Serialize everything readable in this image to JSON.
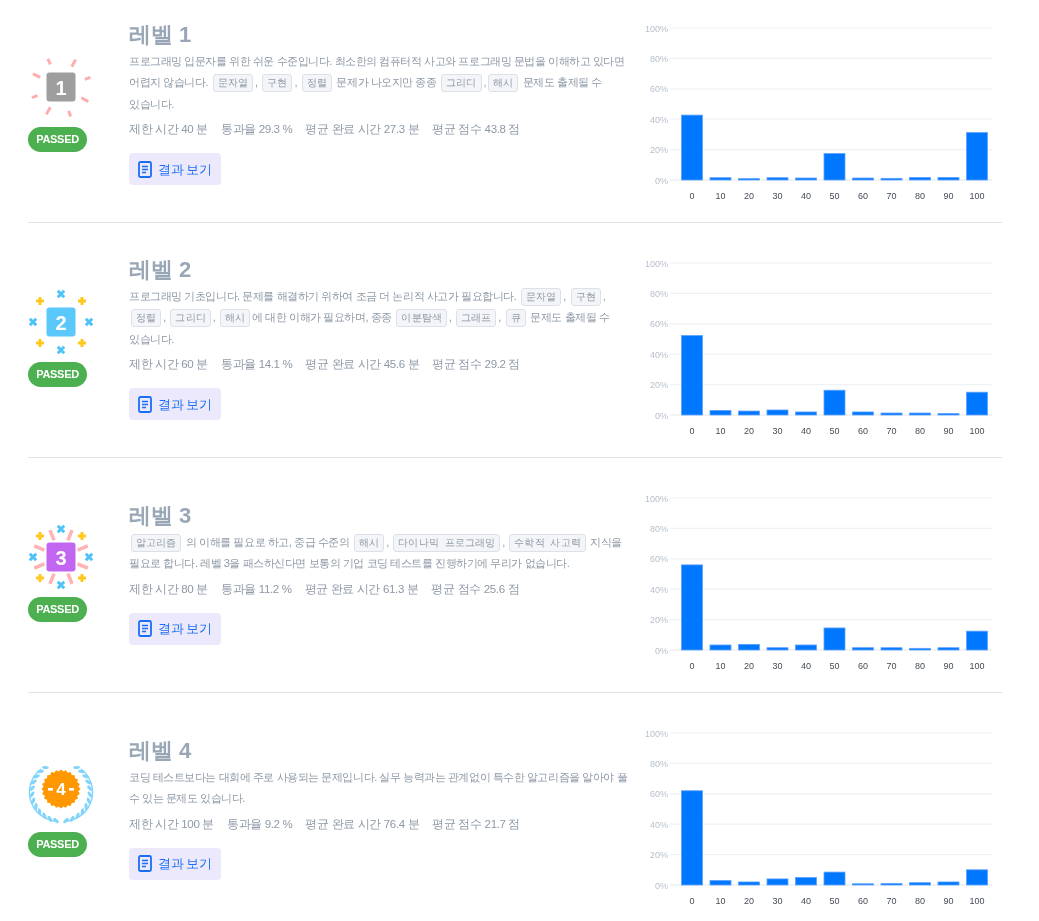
{
  "levels": [
    {
      "title": "레벨 1",
      "badge": {
        "kind": "burst",
        "number": "1"
      },
      "status": "PASSED",
      "description": [
        {
          "kind": "text",
          "text": "프로그래밍 입문자를 위한 쉬운 수준입니다. 최소한의 컴퓨터적 사고와 프로그래밍 문법을 이해하고 있다면 어렵지 않습니다. "
        },
        {
          "kind": "tag",
          "text": "문자열"
        },
        {
          "kind": "text",
          "text": ", "
        },
        {
          "kind": "tag",
          "text": "구현"
        },
        {
          "kind": "text",
          "text": ", "
        },
        {
          "kind": "tag",
          "text": "정렬"
        },
        {
          "kind": "text",
          "text": " 문제가 나오지만 종종 "
        },
        {
          "kind": "tag",
          "text": "그리디"
        },
        {
          "kind": "text",
          "text": ","
        },
        {
          "kind": "tag",
          "text": "해시"
        },
        {
          "kind": "text",
          "text": " 문제도 출제될 수 있습니다."
        }
      ],
      "stats": [
        "제한 시간 40 분",
        "통과율 29.3 %",
        "평균 완료 시간 27.3 분",
        "평균 점수 43.8 점"
      ],
      "button": "결과 보기",
      "chart_data": {
        "type": "bar",
        "categories": [
          "0",
          "10",
          "20",
          "30",
          "40",
          "50",
          "60",
          "70",
          "80",
          "90",
          "100"
        ],
        "values": [
          42.7,
          1.5,
          0.9,
          1.5,
          1.3,
          17.4,
          1.3,
          1.1,
          1.7,
          1.7,
          31.2
        ],
        "ylim": [
          0,
          100
        ],
        "yticks": [
          {
            "value": 0,
            "label": "0%"
          },
          {
            "value": 20,
            "label": "20%"
          },
          {
            "value": 40,
            "label": "40%"
          },
          {
            "value": 60,
            "label": "60%"
          },
          {
            "value": 80,
            "label": "80%"
          },
          {
            "value": 100,
            "label": "100%"
          }
        ],
        "grid": true
      }
    },
    {
      "title": "레벨 2",
      "badge": {
        "kind": "sparkle",
        "number": "2"
      },
      "status": "PASSED",
      "description": [
        {
          "kind": "text",
          "text": "프로그래밍 기초입니다. 문제를 해결하기 위하여 조금 더 논리적 사고가 필요합니다. "
        },
        {
          "kind": "tag",
          "text": "문자열"
        },
        {
          "kind": "text",
          "text": ", "
        },
        {
          "kind": "tag",
          "text": "구현"
        },
        {
          "kind": "text",
          "text": ", "
        },
        {
          "kind": "tag",
          "text": "정렬"
        },
        {
          "kind": "text",
          "text": ", "
        },
        {
          "kind": "tag",
          "text": "그리디"
        },
        {
          "kind": "text",
          "text": ", "
        },
        {
          "kind": "tag",
          "text": "해시"
        },
        {
          "kind": "text",
          "text": "에 대한 이해가 필요하며, 종종 "
        },
        {
          "kind": "tag",
          "text": "이분탐색"
        },
        {
          "kind": "text",
          "text": ", "
        },
        {
          "kind": "tag",
          "text": "그래프"
        },
        {
          "kind": "text",
          "text": ", "
        },
        {
          "kind": "tag",
          "text": "큐"
        },
        {
          "kind": "text",
          "text": " 문제도 출제될 수 있습니다."
        }
      ],
      "stats": [
        "제한 시간 60 분",
        "통과율 14.1 %",
        "평균 완료 시간 45.6 분",
        "평균 점수 29.2 점"
      ],
      "button": "결과 보기",
      "chart_data": {
        "type": "bar",
        "categories": [
          "0",
          "10",
          "20",
          "30",
          "40",
          "50",
          "60",
          "70",
          "80",
          "90",
          "100"
        ],
        "values": [
          52.3,
          3.0,
          2.6,
          3.3,
          2.0,
          16.3,
          2.0,
          1.3,
          1.3,
          1.0,
          15.0
        ],
        "ylim": [
          0,
          100
        ],
        "yticks": [
          {
            "value": 0,
            "label": "0%"
          },
          {
            "value": 20,
            "label": "20%"
          },
          {
            "value": 40,
            "label": "40%"
          },
          {
            "value": 60,
            "label": "60%"
          },
          {
            "value": 80,
            "label": "80%"
          },
          {
            "value": 100,
            "label": "100%"
          }
        ],
        "grid": true
      }
    },
    {
      "title": "레벨 3",
      "badge": {
        "kind": "starburst",
        "number": "3"
      },
      "status": "PASSED",
      "description": [
        {
          "kind": "tag",
          "text": "알고리즘"
        },
        {
          "kind": "text",
          "text": " 의 이해를 필요로 하고, 중급 수준의 "
        },
        {
          "kind": "tag",
          "text": "해시"
        },
        {
          "kind": "text",
          "text": ", "
        },
        {
          "kind": "tag",
          "text": "다이나믹 프로그래밍"
        },
        {
          "kind": "text",
          "text": ", "
        },
        {
          "kind": "tag",
          "text": "수학적 사고력"
        },
        {
          "kind": "text",
          "text": " 지식을 필요로 합니다. 레벨 3을 패스하신다면 보통의 기업 코딩 테스트를 진행하기에 무리가 없습니다."
        }
      ],
      "stats": [
        "제한 시간 80 분",
        "통과율 11.2 %",
        "평균 완료 시간 61.3 분",
        "평균 점수 25.6 점"
      ],
      "button": "결과 보기",
      "chart_data": {
        "type": "bar",
        "categories": [
          "0",
          "10",
          "20",
          "30",
          "40",
          "50",
          "60",
          "70",
          "80",
          "90",
          "100"
        ],
        "values": [
          56.0,
          3.3,
          3.7,
          1.5,
          3.3,
          14.5,
          1.5,
          1.5,
          1.1,
          1.5,
          12.4
        ],
        "ylim": [
          0,
          100
        ],
        "yticks": [
          {
            "value": 0,
            "label": "0%"
          },
          {
            "value": 20,
            "label": "20%"
          },
          {
            "value": 40,
            "label": "40%"
          },
          {
            "value": 60,
            "label": "60%"
          },
          {
            "value": 80,
            "label": "80%"
          },
          {
            "value": 100,
            "label": "100%"
          }
        ],
        "grid": true
      }
    },
    {
      "title": "레벨 4",
      "badge": {
        "kind": "laurel",
        "number": "4"
      },
      "status": "PASSED",
      "description": [
        {
          "kind": "text",
          "text": "코딩 테스트보다는 대회에 주로 사용되는 문제입니다. 실무 능력과는 관계없이 특수한 알고리즘을 알아야 풀 수 있는 문제도 있습니다."
        }
      ],
      "stats": [
        "제한 시간 100 분",
        "통과율 9.2 %",
        "평균 완료 시간 76.4 분",
        "평균 점수 21.7 점"
      ],
      "button": "결과 보기",
      "chart_data": {
        "type": "bar",
        "categories": [
          "0",
          "10",
          "20",
          "30",
          "40",
          "50",
          "60",
          "70",
          "80",
          "90",
          "100"
        ],
        "values": [
          62.0,
          3.0,
          2.0,
          4.0,
          5.0,
          8.5,
          0.8,
          1.0,
          1.5,
          2.0,
          10.0
        ],
        "ylim": [
          0,
          100
        ],
        "yticks": [
          {
            "value": 0,
            "label": "0%"
          },
          {
            "value": 20,
            "label": "20%"
          },
          {
            "value": 40,
            "label": "40%"
          },
          {
            "value": 60,
            "label": "60%"
          },
          {
            "value": 80,
            "label": "80%"
          },
          {
            "value": 100,
            "label": "100%"
          }
        ],
        "grid": true
      }
    }
  ]
}
